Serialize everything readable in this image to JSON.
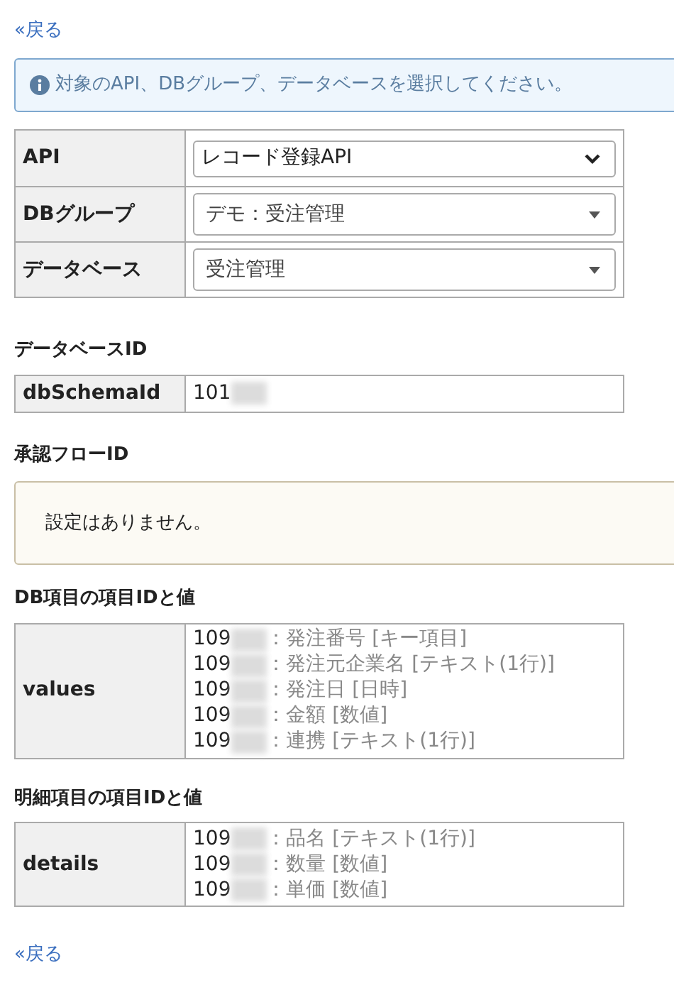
{
  "back_link_top": "«戻る",
  "alert": {
    "text": "対象のAPI、DBグループ、データベースを選択してください。"
  },
  "selection_table": [
    {
      "label": "API",
      "value": "レコード登録API",
      "kind": "native"
    },
    {
      "label": "DBグループ",
      "value": "デモ：受注管理",
      "kind": "custom"
    },
    {
      "label": "データベース",
      "value": "受注管理",
      "kind": "custom"
    }
  ],
  "database_id": {
    "heading": "データベースID",
    "label": "dbSchemaId",
    "value": "101"
  },
  "approval_flow": {
    "heading": "承認フローID",
    "message": "設定はありません。"
  },
  "db_fields": {
    "heading": "DB項目の項目IDと値",
    "label": "values",
    "items": [
      {
        "id": "109",
        "name": "：発注番号 [キー項目]"
      },
      {
        "id": "109",
        "name": "：発注元企業名 [テキスト(1行)]"
      },
      {
        "id": "109",
        "name": "：発注日 [日時]"
      },
      {
        "id": "109",
        "name": "：金額 [数値]"
      },
      {
        "id": "109",
        "name": "：連携 [テキスト(1行)]"
      }
    ]
  },
  "detail_fields": {
    "heading": "明細項目の項目IDと値",
    "label": "details",
    "items": [
      {
        "id": "109",
        "name": "：品名 [テキスト(1行)]"
      },
      {
        "id": "109",
        "name": "：数量 [数値]"
      },
      {
        "id": "109",
        "name": "：単価 [数値]"
      }
    ]
  },
  "back_link_bottom": "«戻る"
}
